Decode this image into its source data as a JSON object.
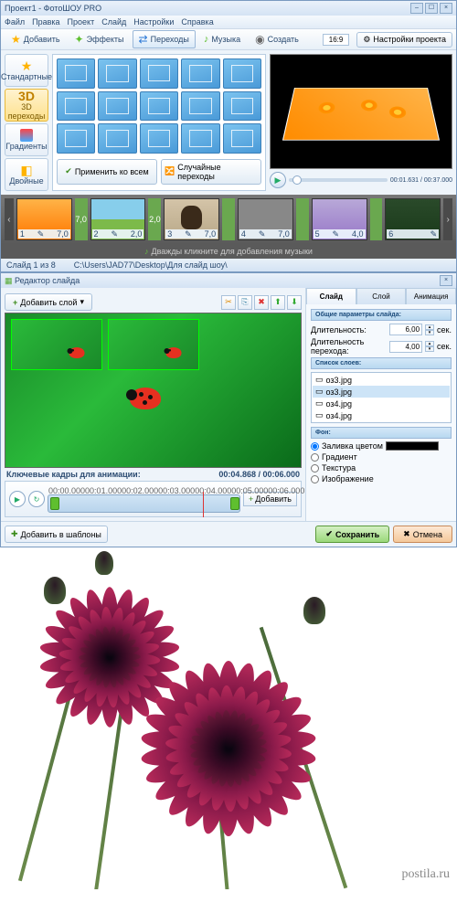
{
  "win1": {
    "title": "Проект1 - ФотоШОУ PRO",
    "menu": [
      "Файл",
      "Правка",
      "Проект",
      "Слайд",
      "Настройки",
      "Справка"
    ],
    "toolbar": {
      "add": "Добавить",
      "effects": "Эффекты",
      "transitions": "Переходы",
      "music": "Музыка",
      "create": "Создать",
      "aspect": "16:9",
      "proj_settings": "Настройки проекта"
    },
    "sidebar": [
      {
        "label": "Стандартные",
        "sel": false
      },
      {
        "label": "3D переходы",
        "sel": true,
        "big": "3D"
      },
      {
        "label": "Градиенты",
        "sel": false
      },
      {
        "label": "Двойные",
        "sel": false
      }
    ],
    "apply_all": "Применить ко всем",
    "random": "Случайные переходы",
    "time": "00:01.631 / 00:37.000",
    "thumbs": [
      {
        "n": "1",
        "d": "7,0"
      },
      {
        "n": "2",
        "d": "7,0"
      },
      {
        "n": "",
        "d": "2,0"
      },
      {
        "n": "3",
        "d": "2,0"
      },
      {
        "n": "",
        "d": "7,0"
      },
      {
        "n": "4",
        "d": "7,0"
      },
      {
        "n": "5",
        "d": ""
      },
      {
        "n": "",
        "d": "4,0"
      },
      {
        "n": "6",
        "d": ""
      }
    ],
    "music_hint": "Дважды кликните для добавления музыки",
    "status_left": "Слайд 1 из 8",
    "status_path": "C:\\Users\\JAD77\\Desktop\\Для слайд шоу\\"
  },
  "win2": {
    "title": "Редактор слайда",
    "add_layer": "Добавить слой",
    "tabs": [
      "Слайд",
      "Слой",
      "Анимация"
    ],
    "params_head": "Общие параметры слайда:",
    "duration_label": "Длительность:",
    "duration_val": "6,00",
    "trans_dur_label": "Длительность перехода:",
    "trans_dur_val": "4,00",
    "sec": "сек.",
    "layers_head": "Список слоев:",
    "layers": [
      "оз3.jpg",
      "оз3.jpg",
      "оз4.jpg",
      "оз4.jpg"
    ],
    "bg_head": "Фон:",
    "bg_opts": [
      "Заливка цветом",
      "Градиент",
      "Текстура",
      "Изображение"
    ],
    "kf_title": "Ключевые кадры для анимации:",
    "kf_time": "00:04.868 / 00:06.000",
    "kf_ticks": [
      "00:00.000",
      "00:01.000",
      "00:02.000",
      "00:03.000",
      "00:04.000",
      "00:05.000",
      "00:06.000"
    ],
    "kf_add": "Добавить",
    "templates": "Добавить в шаблоны",
    "save": "Сохранить",
    "cancel": "Отмена"
  },
  "watermark": "postila.ru"
}
